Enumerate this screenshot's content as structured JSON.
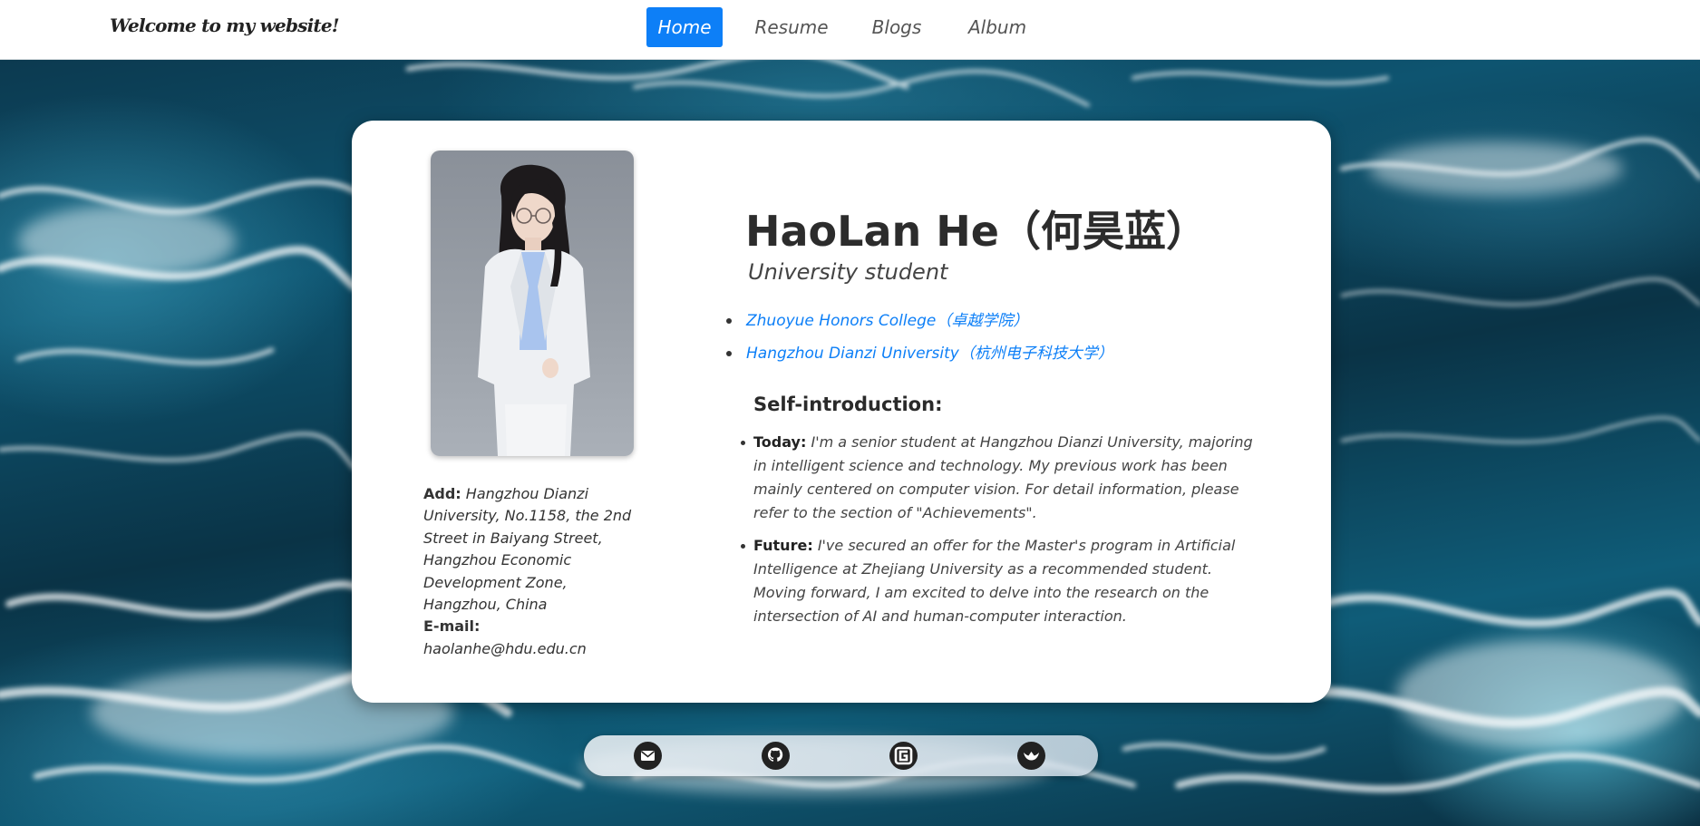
{
  "header": {
    "brand": "Welcome to my website!",
    "nav": [
      {
        "label": "Home",
        "active": true
      },
      {
        "label": "Resume",
        "active": false
      },
      {
        "label": "Blogs",
        "active": false
      },
      {
        "label": "Album",
        "active": false
      }
    ]
  },
  "profile": {
    "name": "HaoLan He（何昊蓝）",
    "role": "University student",
    "affiliations": [
      "Zhuoyue Honors College（卓越学院）",
      "Hangzhou Dianzi University（杭州电子科技大学）"
    ],
    "contact": {
      "address_label": "Add:",
      "address": "Hangzhou Dianzi University, No.1158, the 2nd Street in Baiyang Street, Hangzhou Economic Development Zone, Hangzhou, China",
      "email_label": "E-mail:",
      "email": "haolanhe@hdu.edu.cn"
    },
    "self_intro": {
      "title": "Self-introduction:",
      "items": [
        {
          "key": "Today",
          "text": "I'm a senior student at Hangzhou Dianzi University, majoring in intelligent science and technology. My previous work has been mainly centered on computer vision. For detail information, please refer to the section of \"Achievements\"."
        },
        {
          "key": "Future",
          "text": "I've secured an offer for the Master's program in Artificial Intelligence at Zhejiang University as a recommended student. Moving forward, I am excited to delve into the research on the intersection of AI and human-computer interaction."
        }
      ]
    }
  },
  "social": [
    {
      "icon": "email-icon"
    },
    {
      "icon": "github-icon"
    },
    {
      "icon": "google-scholar-icon"
    },
    {
      "icon": "bird-icon"
    }
  ],
  "colors": {
    "accent": "#0d7ff7",
    "link": "#0d7ff7",
    "card": "#ffffff"
  }
}
